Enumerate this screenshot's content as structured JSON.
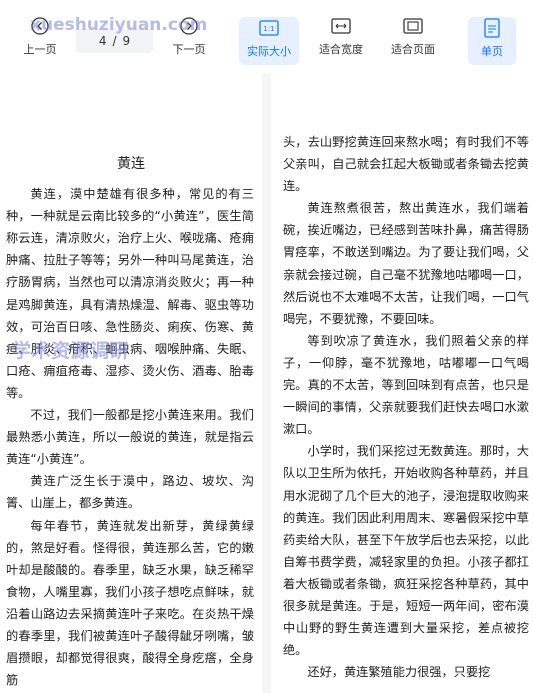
{
  "toolbar": {
    "prev_label": "上一页",
    "next_label": "下一页",
    "current_page": "4",
    "separator": "/",
    "total_pages": "9",
    "actual_size_label": "实际大小",
    "fit_width_label": "适合宽度",
    "fit_page_label": "适合页面",
    "single_page_label": "单页",
    "actual_size_icon_text": "1:1",
    "accent_color": "#1677ff"
  },
  "left_page": {
    "title": "黄连",
    "paragraphs": [
      "黄连，漠中楚雄有很多种，常见的有三种，一种就是云南比较多的“小黄连”，医生简称云连，清凉败火，治疗上火、喉咙痛、疮痈肿痛、拉肚子等等；另外一种叫马尾黄连，治疗肠胃病，当然也可以清凉消炎败火；再一种是鸡脚黄连，具有清热燥湿、解毒、驱虫等功效，可治百日咳、急性肠炎、痢疾、伤寒、黄疸、肝炎、疳积、蛔虫病、咽喉肿痛、失眠、口疮、痈疽疮毒、湿疹、烫火伤、酒毒、胎毒等。",
      "不过，我们一般都是挖小黄连来用。我们最熟悉小黄连，所以一般说的黄连，就是指云黄连“小黄连”。",
      "黄连广泛生长于漠中，路边、坡坎、沟箐、山崖上，都多黄连。",
      "每年春节，黄连就发出新芽，黄绿黄绿的，煞是好看。怪得很，黄连那么苦，它的嫩叶却是酸酸的。春季里，缺乏水果，缺乏稀罕食物，人嘴里寡，我们小孩子想吃点鲜味，就沿着山路边去采摘黄连叶子来吃。在炎热干燥的春季里，我们被黄连叶子酸得龇牙咧嘴，皱眉攒眼，却都觉得很爽，酸得全身疙瘩，全身筋"
    ]
  },
  "right_page": {
    "paragraphs": [
      "头，去山野挖黄连回来熬水喝；有时我们不等父亲叫，自己就会扛起大板锄或者条锄去挖黄连。",
      "黄连熬煮很苦，熬出黄连水，我们端着碗，挨近嘴边，已经感到苦味扑鼻，痛苦得肠胃痉挛，不敢送到嘴边。为了要让我们喝，父亲就会接过碗，自己毫不犹豫地咕嘟喝一口，然后说也不太难喝不太苦，让我们喝，一口气喝完，不要犹豫，不要回味。",
      "等到吹凉了黄连水，我们照着父亲的样子，一仰脖，毫不犹豫地，咕嘟嘟一口气喝完。真的不太苦，等到回味到有点苦，也只是一瞬间的事情，父亲就要我们赶快去喝口水漱漱口。",
      "小学时，我们采挖过无数黄连。那时，大队以卫生所为依托，开始收购各种草药，并且用水泥砌了几个巨大的池子，浸泡提取收购来的黄连。我们因此利用周末、寒暑假采挖中草药卖给大队，甚至下午放学后也去采挖，以此自筹书费学费，减轻家里的负担。小孩子都扛着大板锄或者条锄，疯狂采挖各种草药，其中很多就是黄连。于是，短短一两年间，密布漠中山野的野生黄连遭到大量采挖，差点被挖绝。",
      "还好，黄连繁殖能力很强，只要挖"
    ]
  },
  "watermark": {
    "site": "xueshuziyuan.com",
    "line1": "学术资源调研",
    "line2": ""
  }
}
